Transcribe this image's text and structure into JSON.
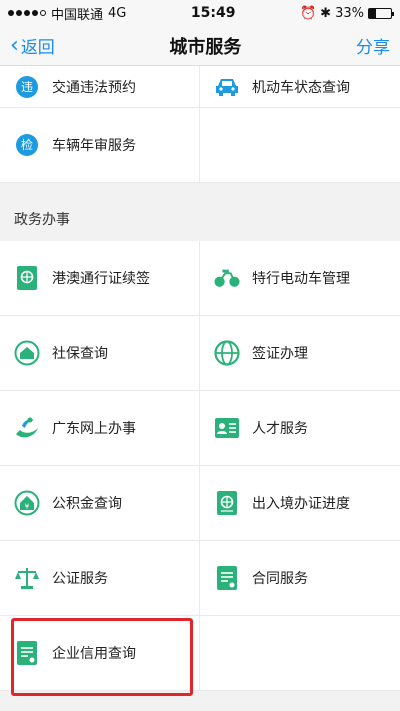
{
  "status_bar": {
    "carrier": "中国联通",
    "network": "4G",
    "time": "15:49",
    "battery": "33%",
    "battery_level": 0.33
  },
  "nav": {
    "back_label": "返回",
    "title": "城市服务",
    "share_label": "分享"
  },
  "top_items": [
    {
      "label": "交通违法预约",
      "icon": "traffic-violation-icon"
    },
    {
      "label": "机动车状态查询",
      "icon": "car-icon"
    },
    {
      "label": "车辆年审服务",
      "icon": "inspection-icon"
    }
  ],
  "section": {
    "title": "政务办事"
  },
  "gov_items": [
    {
      "label": "港澳通行证续签",
      "icon": "passport-icon"
    },
    {
      "label": "特行电动车管理",
      "icon": "ebike-icon"
    },
    {
      "label": "社保查询",
      "icon": "social-security-icon"
    },
    {
      "label": "签证办理",
      "icon": "globe-icon"
    },
    {
      "label": "广东网上办事",
      "icon": "guangdong-online-icon"
    },
    {
      "label": "人才服务",
      "icon": "id-card-icon"
    },
    {
      "label": "公积金查询",
      "icon": "housing-fund-icon"
    },
    {
      "label": "出入境办证进度",
      "icon": "entry-exit-icon"
    },
    {
      "label": "公证服务",
      "icon": "scales-icon"
    },
    {
      "label": "合同服务",
      "icon": "contract-icon"
    },
    {
      "label": "企业信用查询",
      "icon": "credit-document-icon"
    }
  ],
  "colors": {
    "accent_blue": "#1a8cf0",
    "icon_green": "#2bb27a",
    "icon_blue": "#1e9be0",
    "highlight_red": "#e0262b"
  }
}
